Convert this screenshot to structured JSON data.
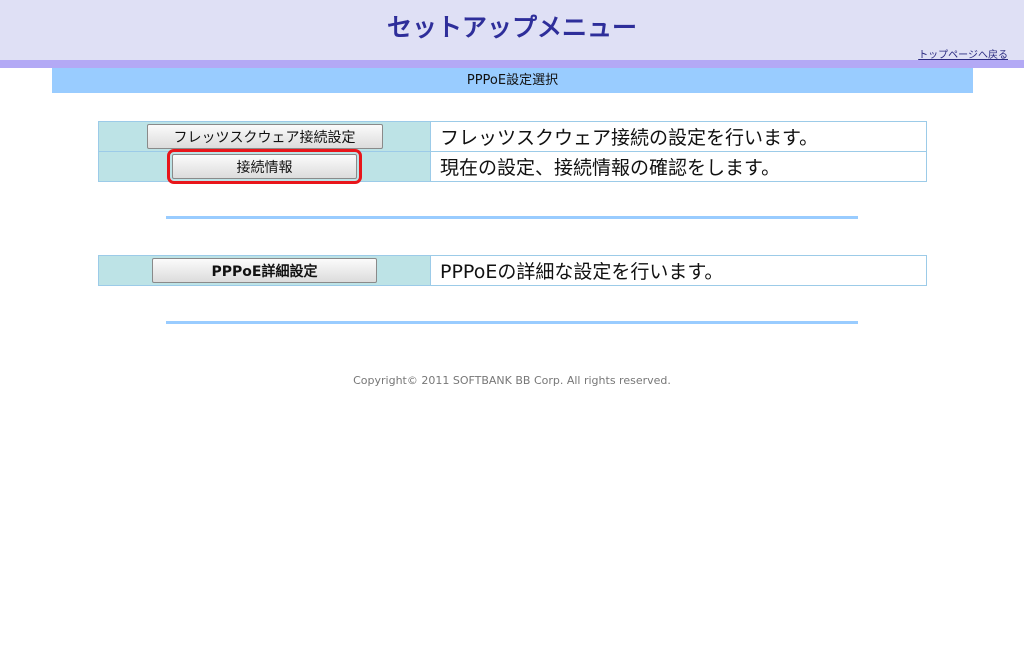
{
  "header": {
    "title": "セットアップメニュー",
    "top_link": "トップページへ戻る"
  },
  "section": {
    "title": "PPPoE設定選択"
  },
  "group1": [
    {
      "button": "フレッツスクウェア接続設定",
      "description": "フレッツスクウェア接続の設定を行います。"
    },
    {
      "button": "接続情報",
      "description": "現在の設定、接続情報の確認をします。"
    }
  ],
  "group2": [
    {
      "button": "PPPoE詳細設定",
      "description": "PPPoEの詳細な設定を行います。"
    }
  ],
  "footer": {
    "copyright": "Copyright© 2011 SOFTBANK BB Corp. All rights reserved."
  }
}
